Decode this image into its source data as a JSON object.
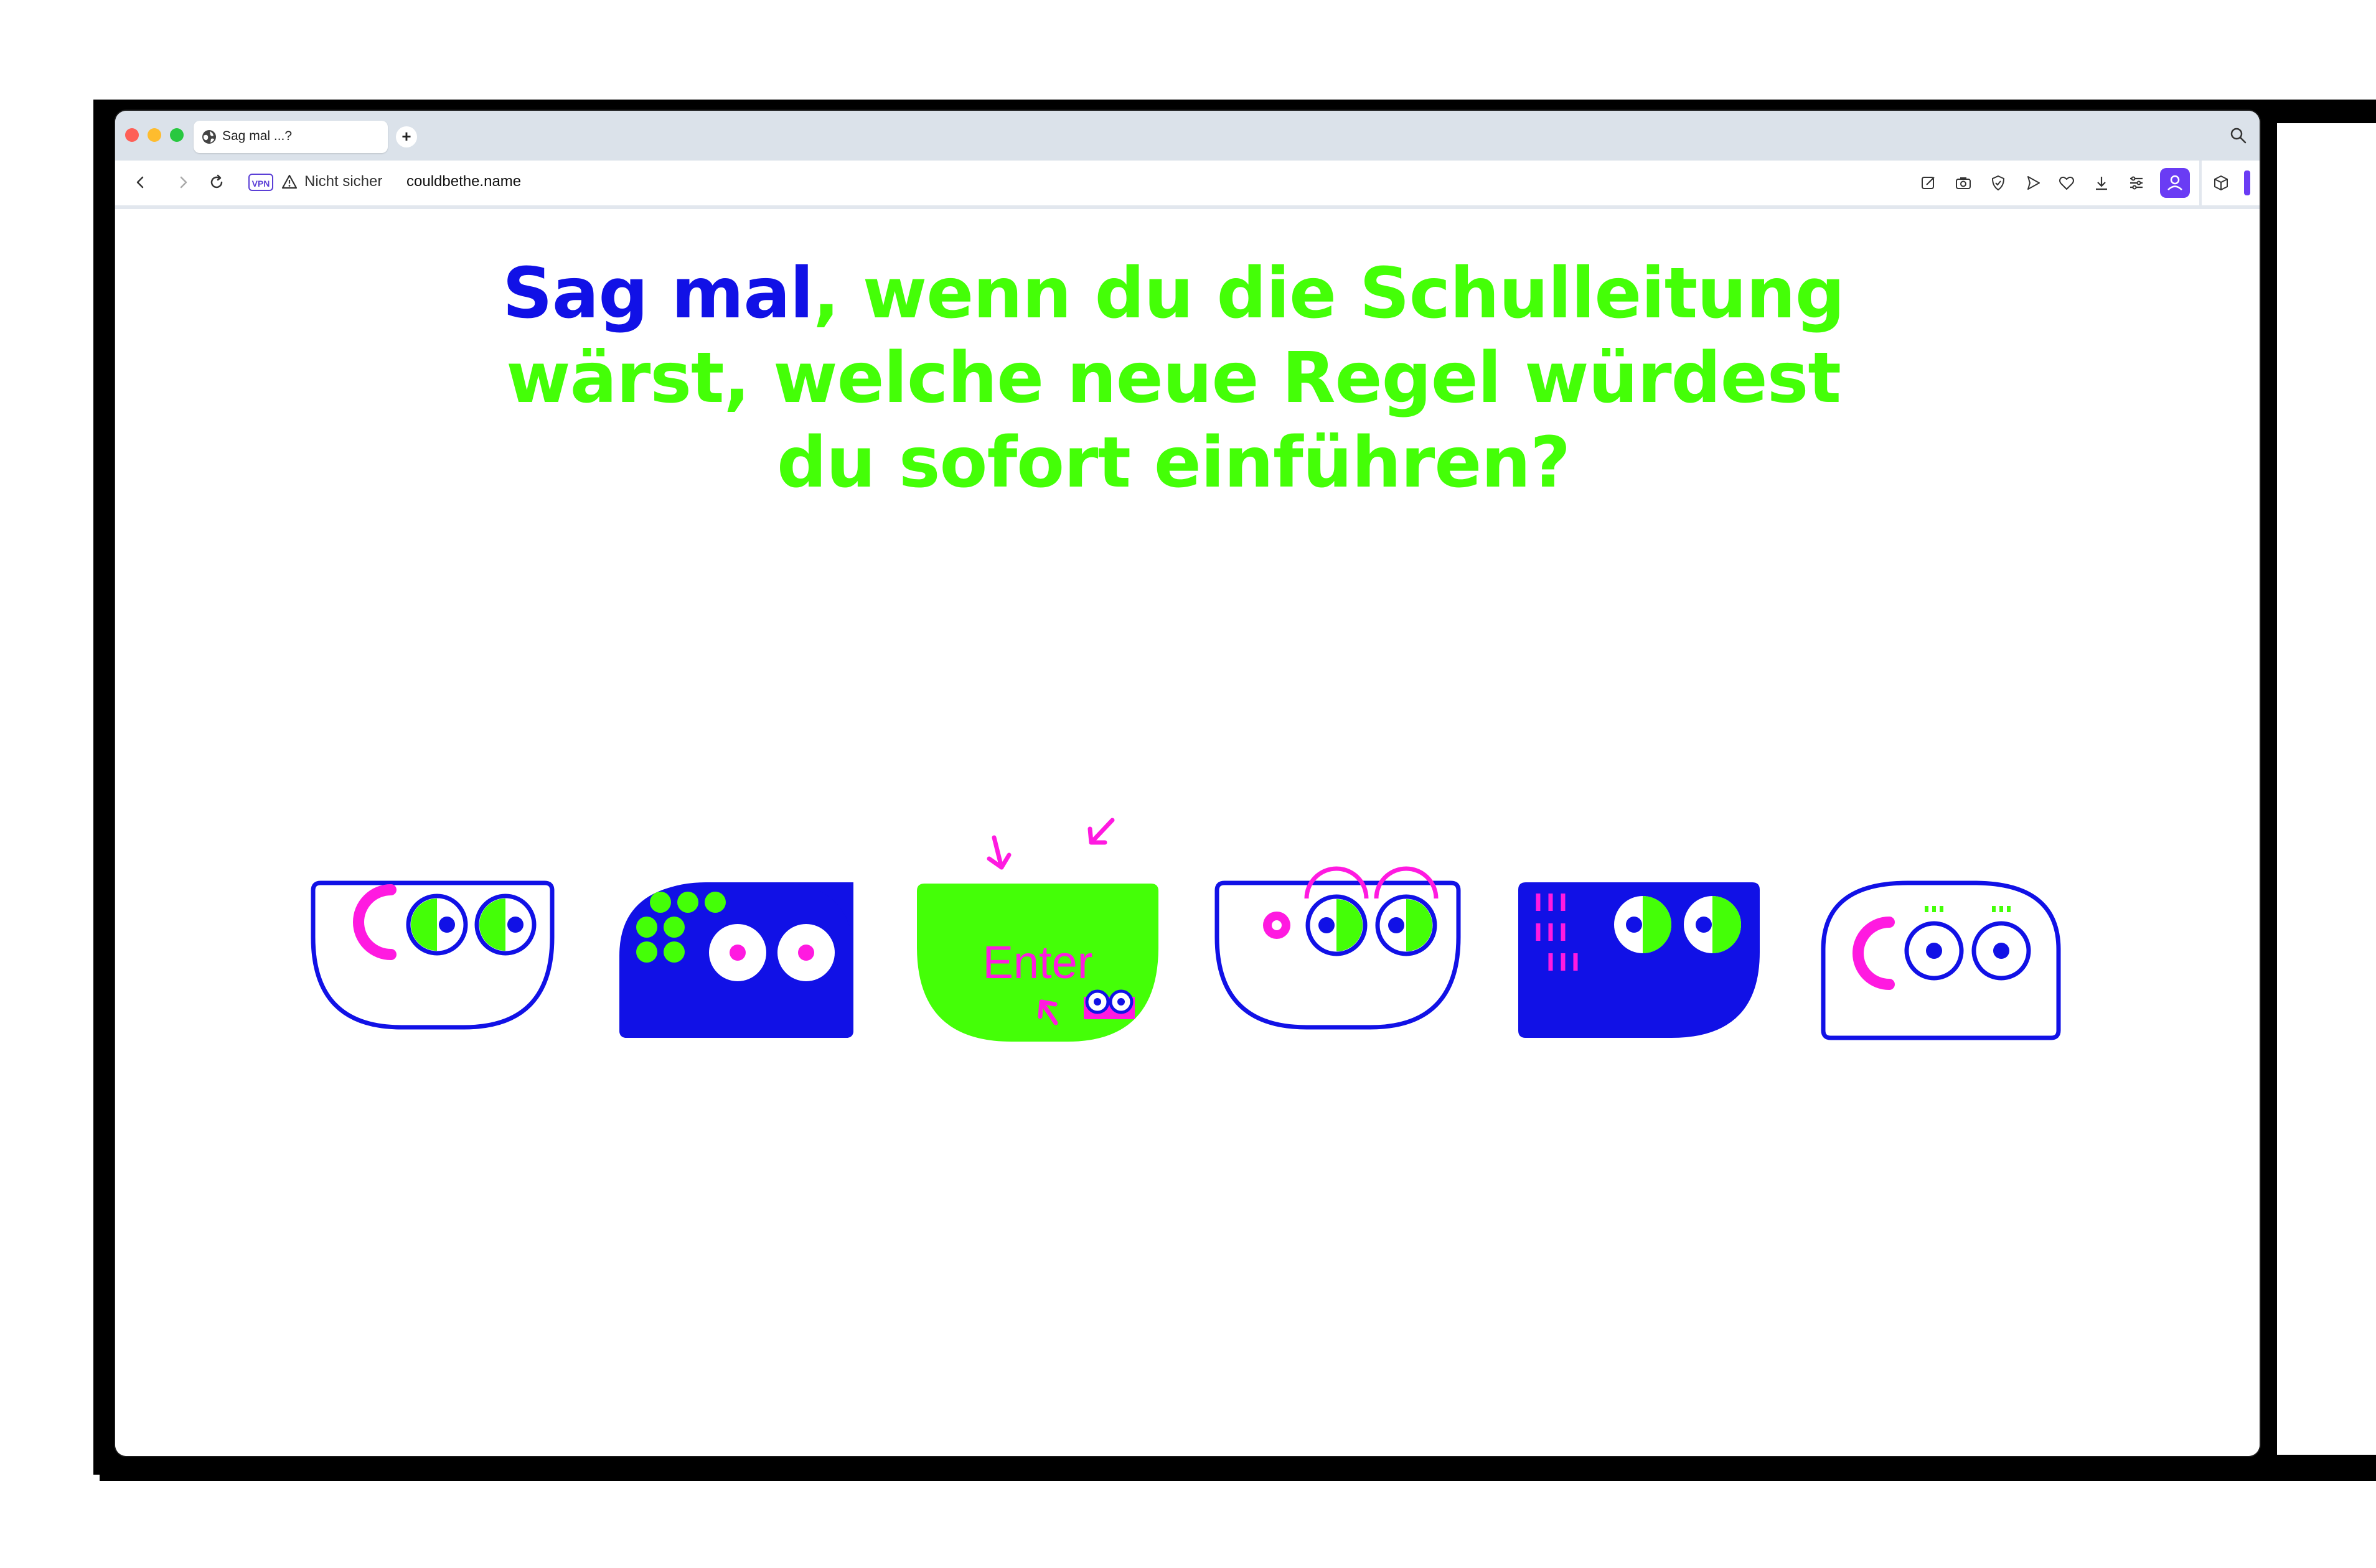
{
  "browser": {
    "tab_title": "Sag mal ...?",
    "new_tab_label": "+",
    "vpn_label": "VPN",
    "security_label": "Nicht sicher",
    "url": "couldbethe.name"
  },
  "page": {
    "question_lead": "Sag mal",
    "question_rest": ", wenn du die Schulleitung wärst, welche neue Regel würdest du sofort einführen?",
    "enter_label": "Enter"
  },
  "colors": {
    "blue": "#1111e6",
    "green": "#44ff07",
    "magenta": "#ff1ae0",
    "profile_purple": "#6a3cf4"
  },
  "icons": [
    "globe-icon",
    "plus-icon",
    "search-icon",
    "back-icon",
    "forward-icon",
    "reload-icon",
    "warning-icon",
    "edit-icon",
    "camera-icon",
    "shield-icon",
    "send-icon",
    "heart-icon",
    "download-icon",
    "menu-icon",
    "profile-icon",
    "cube-icon"
  ]
}
